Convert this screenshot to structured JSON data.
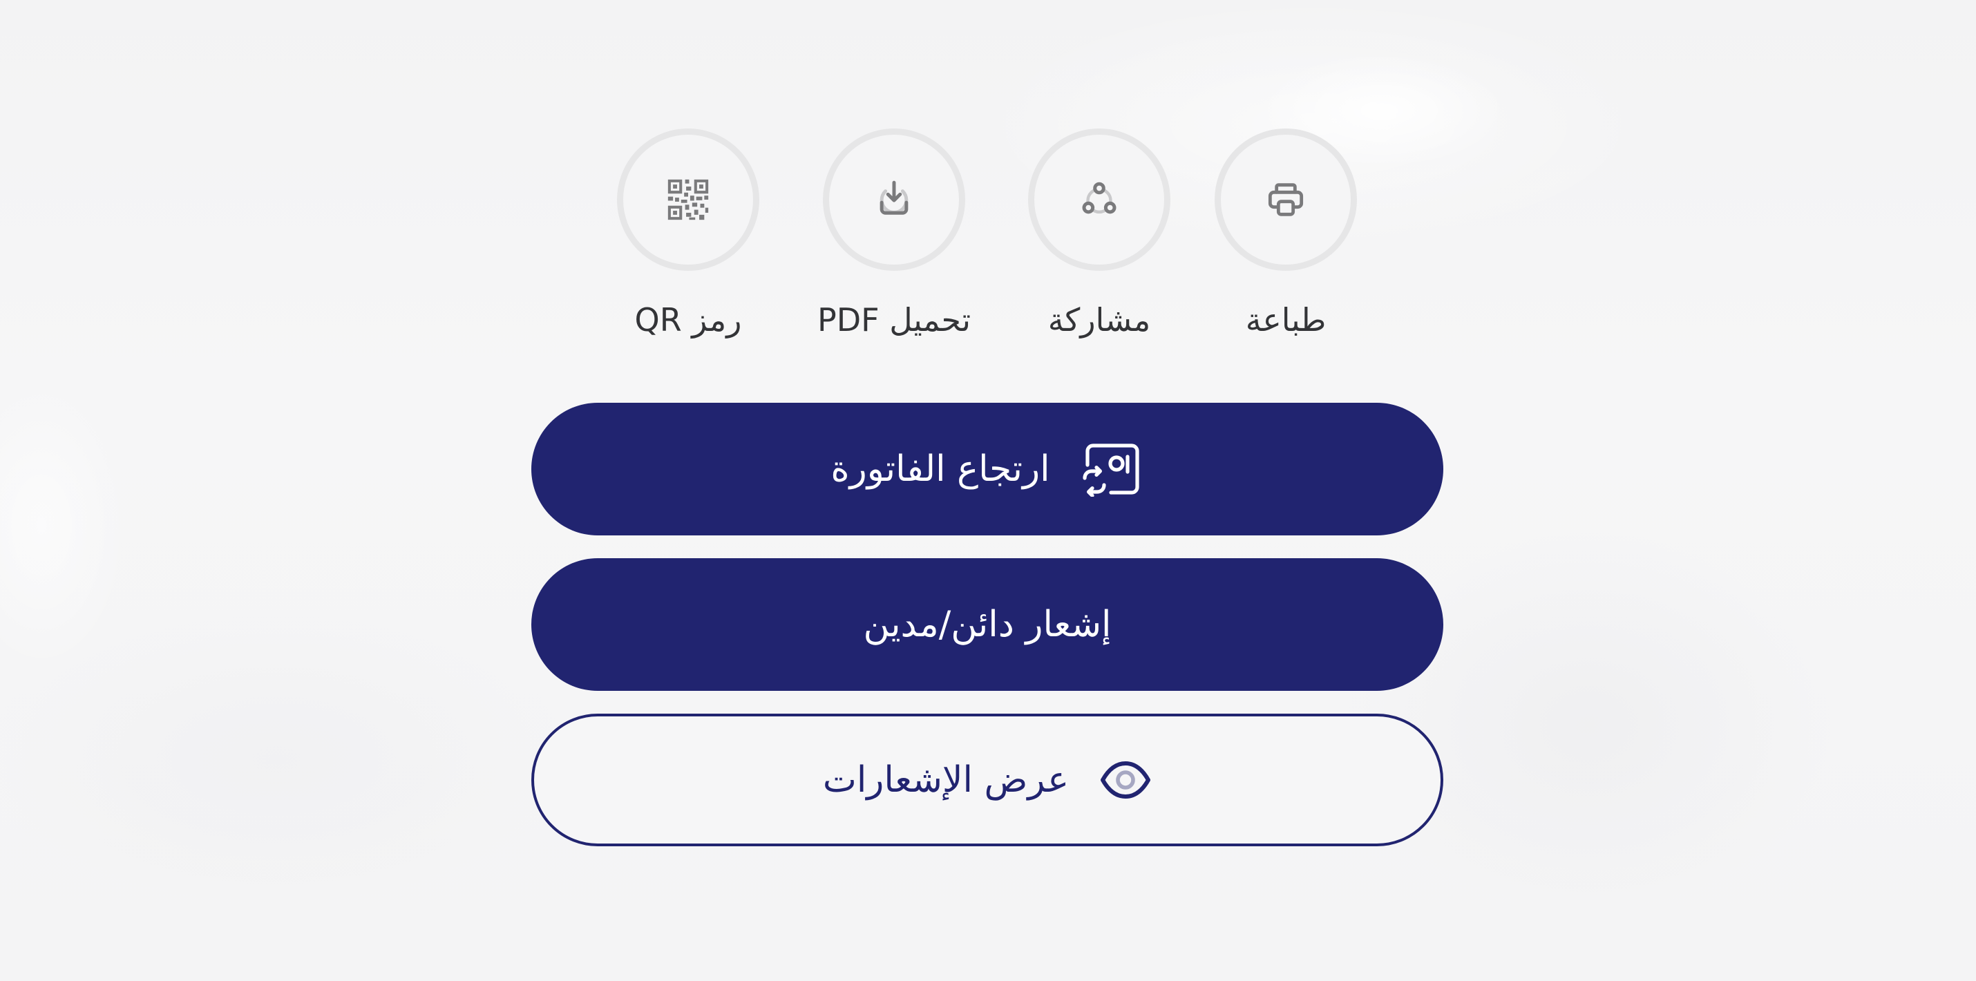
{
  "actions": [
    {
      "id": "print",
      "label": "طباعة",
      "icon": "printer-icon"
    },
    {
      "id": "share",
      "label": "مشاركة",
      "icon": "share-icon"
    },
    {
      "id": "download",
      "label": "تحميل PDF",
      "icon": "download-icon"
    },
    {
      "id": "qr",
      "label": "رمز QR",
      "icon": "qr-code-icon"
    }
  ],
  "buttons": {
    "return_invoice": {
      "label": "ارتجاع الفاتورة",
      "icon": "invoice-return-icon"
    },
    "credit_debit_note": {
      "label": "إشعار دائن/مدين"
    },
    "view_notes": {
      "label": "عرض الإشعارات",
      "icon": "eye-icon"
    }
  },
  "colors": {
    "primary": "#212470",
    "icon_gray": "#7a7a7c",
    "circle_border": "#e6e6e7",
    "text_dark": "#333437",
    "background": "#f5f5f6"
  }
}
